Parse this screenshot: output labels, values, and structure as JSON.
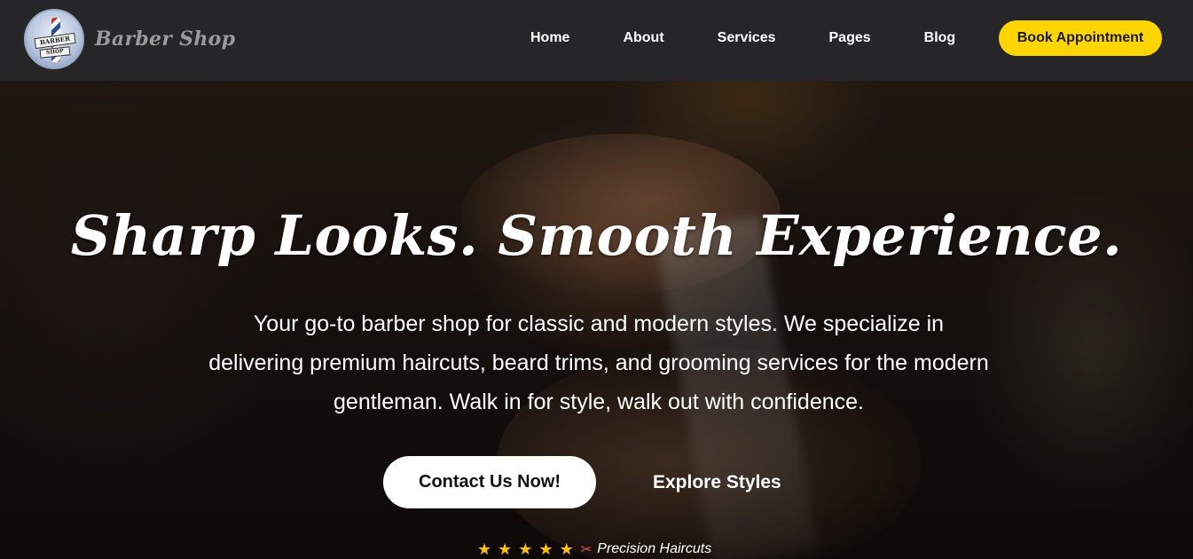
{
  "brand": {
    "name": "Barber Shop",
    "logo_text_top": "BARBER",
    "logo_text_bottom": "SHOP",
    "logo_icon": "barber-pole-icon"
  },
  "nav": {
    "items": [
      "Home",
      "About",
      "Services",
      "Pages",
      "Blog"
    ],
    "cta_label": "Book Appointment",
    "cta_color": "#ffd500",
    "background": "#262628"
  },
  "hero": {
    "headline": "Sharp Looks. Smooth Experience.",
    "intro": "Your go-to barber shop for classic and modern styles. We specialize in delivering premium haircuts, beard trims, and grooming services for the modern gentleman. Walk in for style, walk out with confidence.",
    "primary_button": "Contact Us Now!",
    "secondary_link": "Explore Styles",
    "rating_stars": 5,
    "star_icon": "star-icon",
    "feature_icon": "scissors-icon",
    "feature_label": "Precision Haircuts"
  }
}
